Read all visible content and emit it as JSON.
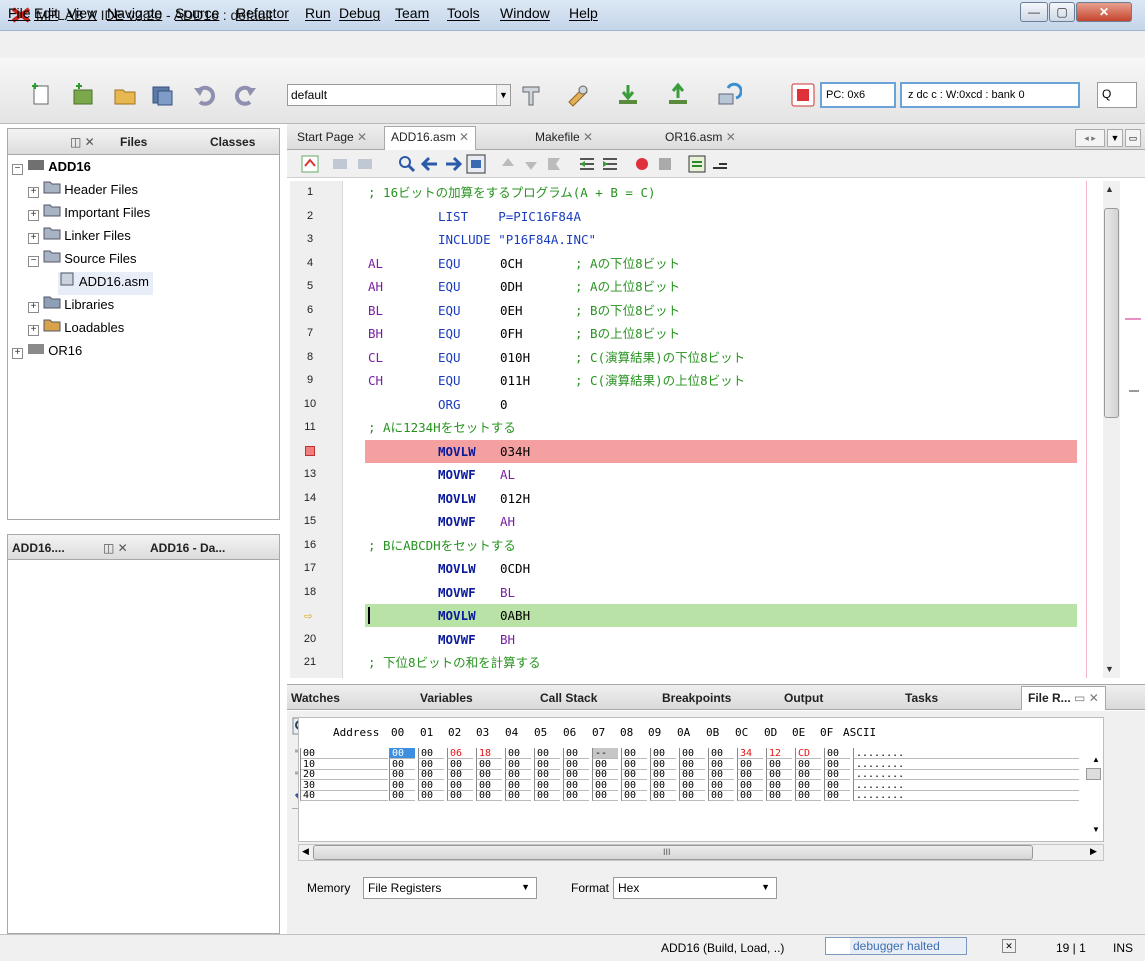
{
  "window": {
    "title": "MPLAB X IDE v2.20 - ADD16 : default"
  },
  "menu": [
    "File",
    "Edit",
    "View",
    "Navigate",
    "Source",
    "Refactor",
    "Run",
    "Debug",
    "Team",
    "Tools",
    "Window",
    "Help"
  ],
  "toolbar": {
    "config": "default",
    "pc": "PC: 0x6",
    "status": "z dc c  : W:0xcd : bank 0",
    "search_icon": "Q"
  },
  "left_panel": {
    "tabs": [
      "Files",
      "Classes"
    ],
    "project": "ADD16",
    "tree": [
      "Header Files",
      "Important Files",
      "Linker Files",
      "Source Files",
      "ADD16.asm",
      "Libraries",
      "Loadables",
      "OR16"
    ]
  },
  "left_panel2": {
    "tabs": [
      "ADD16....",
      "ADD16 - Da..."
    ]
  },
  "editor": {
    "tabs": [
      "Start Page",
      "ADD16.asm",
      "Makefile",
      "OR16.asm"
    ],
    "lines": [
      {
        "n": "1",
        "c": "; 16ビットの加算をするプログラム(A + B = C)"
      },
      {
        "n": "2",
        "c": "LIST    P=PIC16F84A"
      },
      {
        "n": "3",
        "c": "INCLUDE \"P16F84A.INC\""
      },
      {
        "n": "4",
        "a": "AL",
        "b": "EQU",
        "d": "0CH",
        "e": "; Aの下位8ビット"
      },
      {
        "n": "5",
        "a": "AH",
        "b": "EQU",
        "d": "0DH",
        "e": "; Aの上位8ビット"
      },
      {
        "n": "6",
        "a": "BL",
        "b": "EQU",
        "d": "0EH",
        "e": "; Bの下位8ビット"
      },
      {
        "n": "7",
        "a": "BH",
        "b": "EQU",
        "d": "0FH",
        "e": "; Bの上位8ビット"
      },
      {
        "n": "8",
        "a": "CL",
        "b": "EQU",
        "d": "010H",
        "e": "; C(演算結果)の下位8ビット"
      },
      {
        "n": "9",
        "a": "CH",
        "b": "EQU",
        "d": "011H",
        "e": "; C(演算結果)の上位8ビット"
      },
      {
        "n": "10",
        "b": "ORG",
        "d": "0"
      },
      {
        "n": "11",
        "c": "; Aに1234Hをセットする"
      },
      {
        "n": "",
        "b": "MOVLW",
        "d": "034H"
      },
      {
        "n": "13",
        "b": "MOVWF",
        "d": "AL"
      },
      {
        "n": "14",
        "b": "MOVLW",
        "d": "012H"
      },
      {
        "n": "15",
        "b": "MOVWF",
        "d": "AH"
      },
      {
        "n": "16",
        "c": "; BにABCDHをセットする"
      },
      {
        "n": "17",
        "b": "MOVLW",
        "d": "0CDH"
      },
      {
        "n": "18",
        "b": "MOVWF",
        "d": "BL"
      },
      {
        "n": "",
        "b": "MOVLW",
        "d": "0ABH"
      },
      {
        "n": "20",
        "b": "MOVWF",
        "d": "BH"
      },
      {
        "n": "21",
        "c": "; 下位8ビットの和を計算する"
      }
    ]
  },
  "bottom": {
    "tabs": [
      "Watches",
      "Variables",
      "Call Stack",
      "Breakpoints",
      "Output",
      "Tasks",
      "File R..."
    ],
    "header": [
      "Address",
      "00",
      "01",
      "02",
      "03",
      "04",
      "05",
      "06",
      "07",
      "08",
      "09",
      "0A",
      "0B",
      "0C",
      "0D",
      "0E",
      "0F",
      "ASCII"
    ],
    "rows": [
      {
        "addr": "00",
        "cells": [
          "00",
          "00",
          "06",
          "18",
          "00",
          "00",
          "00",
          "--",
          "00",
          "00",
          "00",
          "00",
          "34",
          "12",
          "CD",
          "00"
        ],
        "ascii": "........"
      },
      {
        "addr": "10",
        "cells": [
          "00",
          "00",
          "00",
          "00",
          "00",
          "00",
          "00",
          "00",
          "00",
          "00",
          "00",
          "00",
          "00",
          "00",
          "00",
          "00"
        ],
        "ascii": "........"
      },
      {
        "addr": "20",
        "cells": [
          "00",
          "00",
          "00",
          "00",
          "00",
          "00",
          "00",
          "00",
          "00",
          "00",
          "00",
          "00",
          "00",
          "00",
          "00",
          "00"
        ],
        "ascii": "........"
      },
      {
        "addr": "30",
        "cells": [
          "00",
          "00",
          "00",
          "00",
          "00",
          "00",
          "00",
          "00",
          "00",
          "00",
          "00",
          "00",
          "00",
          "00",
          "00",
          "00"
        ],
        "ascii": "........"
      },
      {
        "addr": "40",
        "cells": [
          "00",
          "00",
          "00",
          "00",
          "00",
          "00",
          "00",
          "00",
          "00",
          "00",
          "00",
          "00",
          "00",
          "00",
          "00",
          "00"
        ],
        "ascii": "........"
      }
    ],
    "memory_label": "Memory",
    "memory_value": "File Registers",
    "format_label": "Format",
    "format_value": "Hex",
    "hscroll_mark": "III"
  },
  "status": {
    "task": "ADD16 (Build, Load, ..)",
    "debugger": "debugger halted",
    "position": "19 | 1",
    "mode": "INS"
  }
}
